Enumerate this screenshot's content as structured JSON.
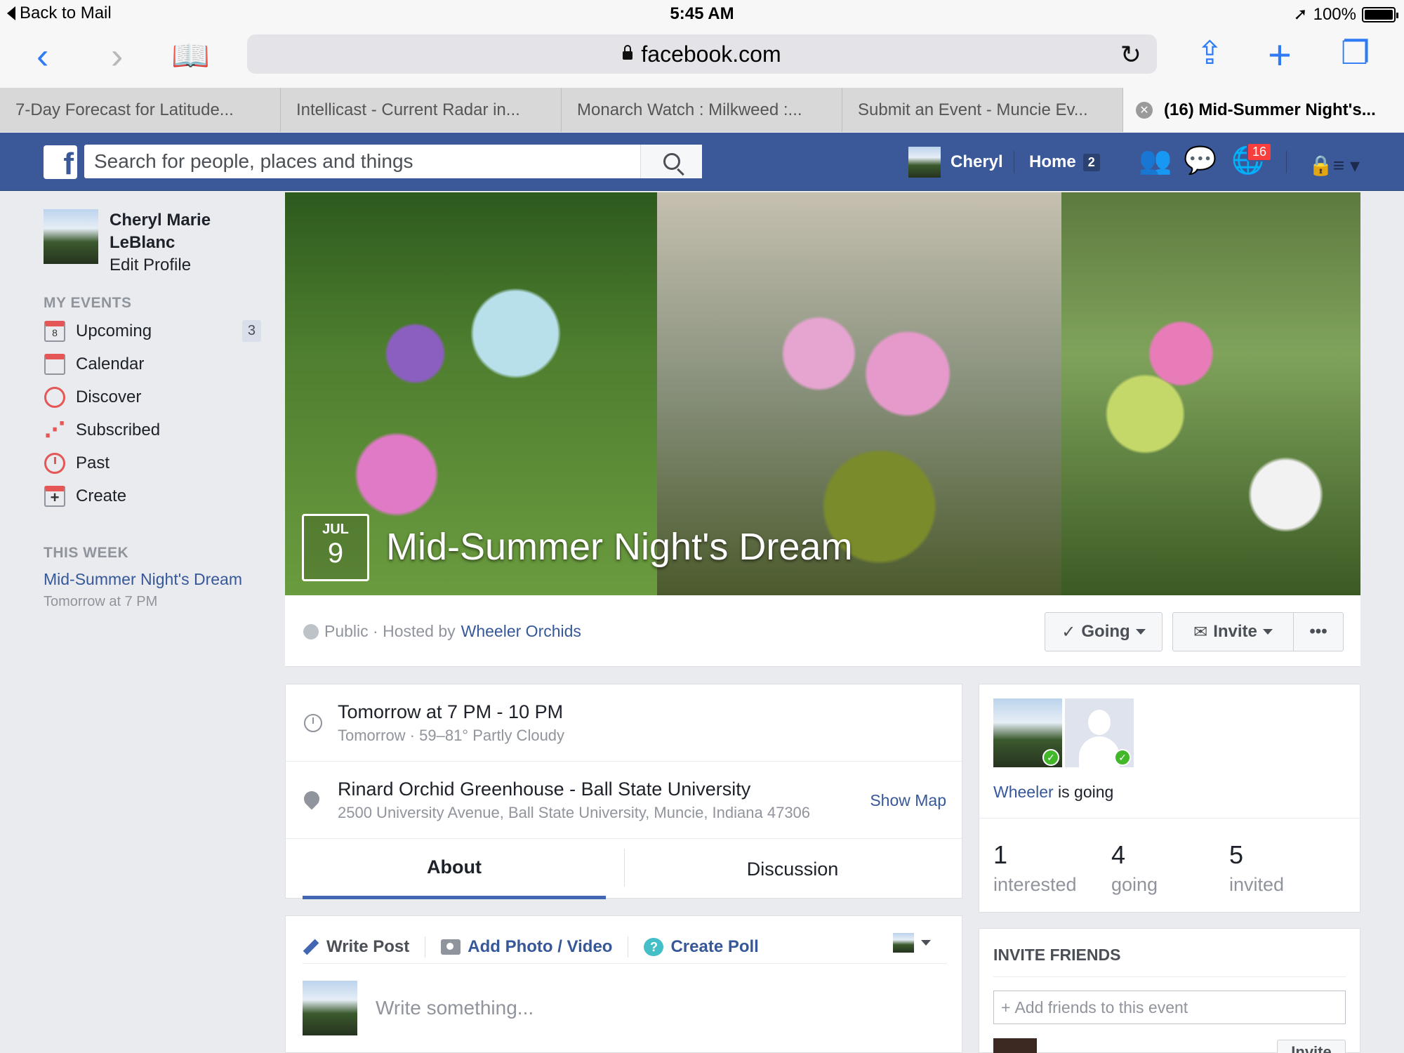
{
  "statusbar": {
    "back_label": "Back to Mail",
    "time": "5:45 AM",
    "battery": "100%"
  },
  "browser": {
    "url": "facebook.com"
  },
  "tabs": [
    {
      "label": "7-Day Forecast for Latitude..."
    },
    {
      "label": "Intellicast - Current Radar in..."
    },
    {
      "label": "Monarch Watch : Milkweed :..."
    },
    {
      "label": "Submit an Event - Muncie Ev..."
    },
    {
      "label": "(16) Mid-Summer Night's..."
    }
  ],
  "fbbar": {
    "search_placeholder": "Search for people, places and things",
    "user_name": "Cheryl",
    "home_label": "Home",
    "home_count": "2",
    "notif_count": "16"
  },
  "sidebar": {
    "profile_name": "Cheryl Marie LeBlanc",
    "edit_profile": "Edit Profile",
    "my_events_header": "MY EVENTS",
    "items": [
      {
        "label": "Upcoming",
        "badge": "3",
        "icon_num": "8"
      },
      {
        "label": "Calendar"
      },
      {
        "label": "Discover"
      },
      {
        "label": "Subscribed"
      },
      {
        "label": "Past"
      },
      {
        "label": "Create"
      }
    ],
    "this_week_header": "THIS WEEK",
    "this_week_event": "Mid-Summer Night's Dream",
    "this_week_time": "Tomorrow at 7 PM"
  },
  "event": {
    "month": "JUL",
    "day": "9",
    "title": "Mid-Summer Night's Dream",
    "privacy": "Public · Hosted by",
    "host": "Wheeler Orchids",
    "going_btn": "Going",
    "invite_btn": "Invite",
    "more_btn": "•••",
    "time_main": "Tomorrow at 7 PM - 10 PM",
    "time_sub": "Tomorrow · 59–81° Partly Cloudy",
    "location_main": "Rinard Orchid Greenhouse - Ball State University",
    "location_sub": "2500 University Avenue, Ball State University, Muncie, Indiana 47306",
    "show_map": "Show Map",
    "tab_about": "About",
    "tab_discussion": "Discussion"
  },
  "composer": {
    "write_post": "Write Post",
    "add_photo": "Add Photo / Video",
    "create_poll": "Create Poll",
    "placeholder": "Write something..."
  },
  "going": {
    "name": "Wheeler",
    "status_text": "is going",
    "stats": [
      {
        "value": "1",
        "label": "interested"
      },
      {
        "value": "4",
        "label": "going"
      },
      {
        "value": "5",
        "label": "invited"
      }
    ]
  },
  "invite": {
    "header": "INVITE FRIENDS",
    "placeholder": "Add friends to this event",
    "invite_btn": "Invite"
  }
}
